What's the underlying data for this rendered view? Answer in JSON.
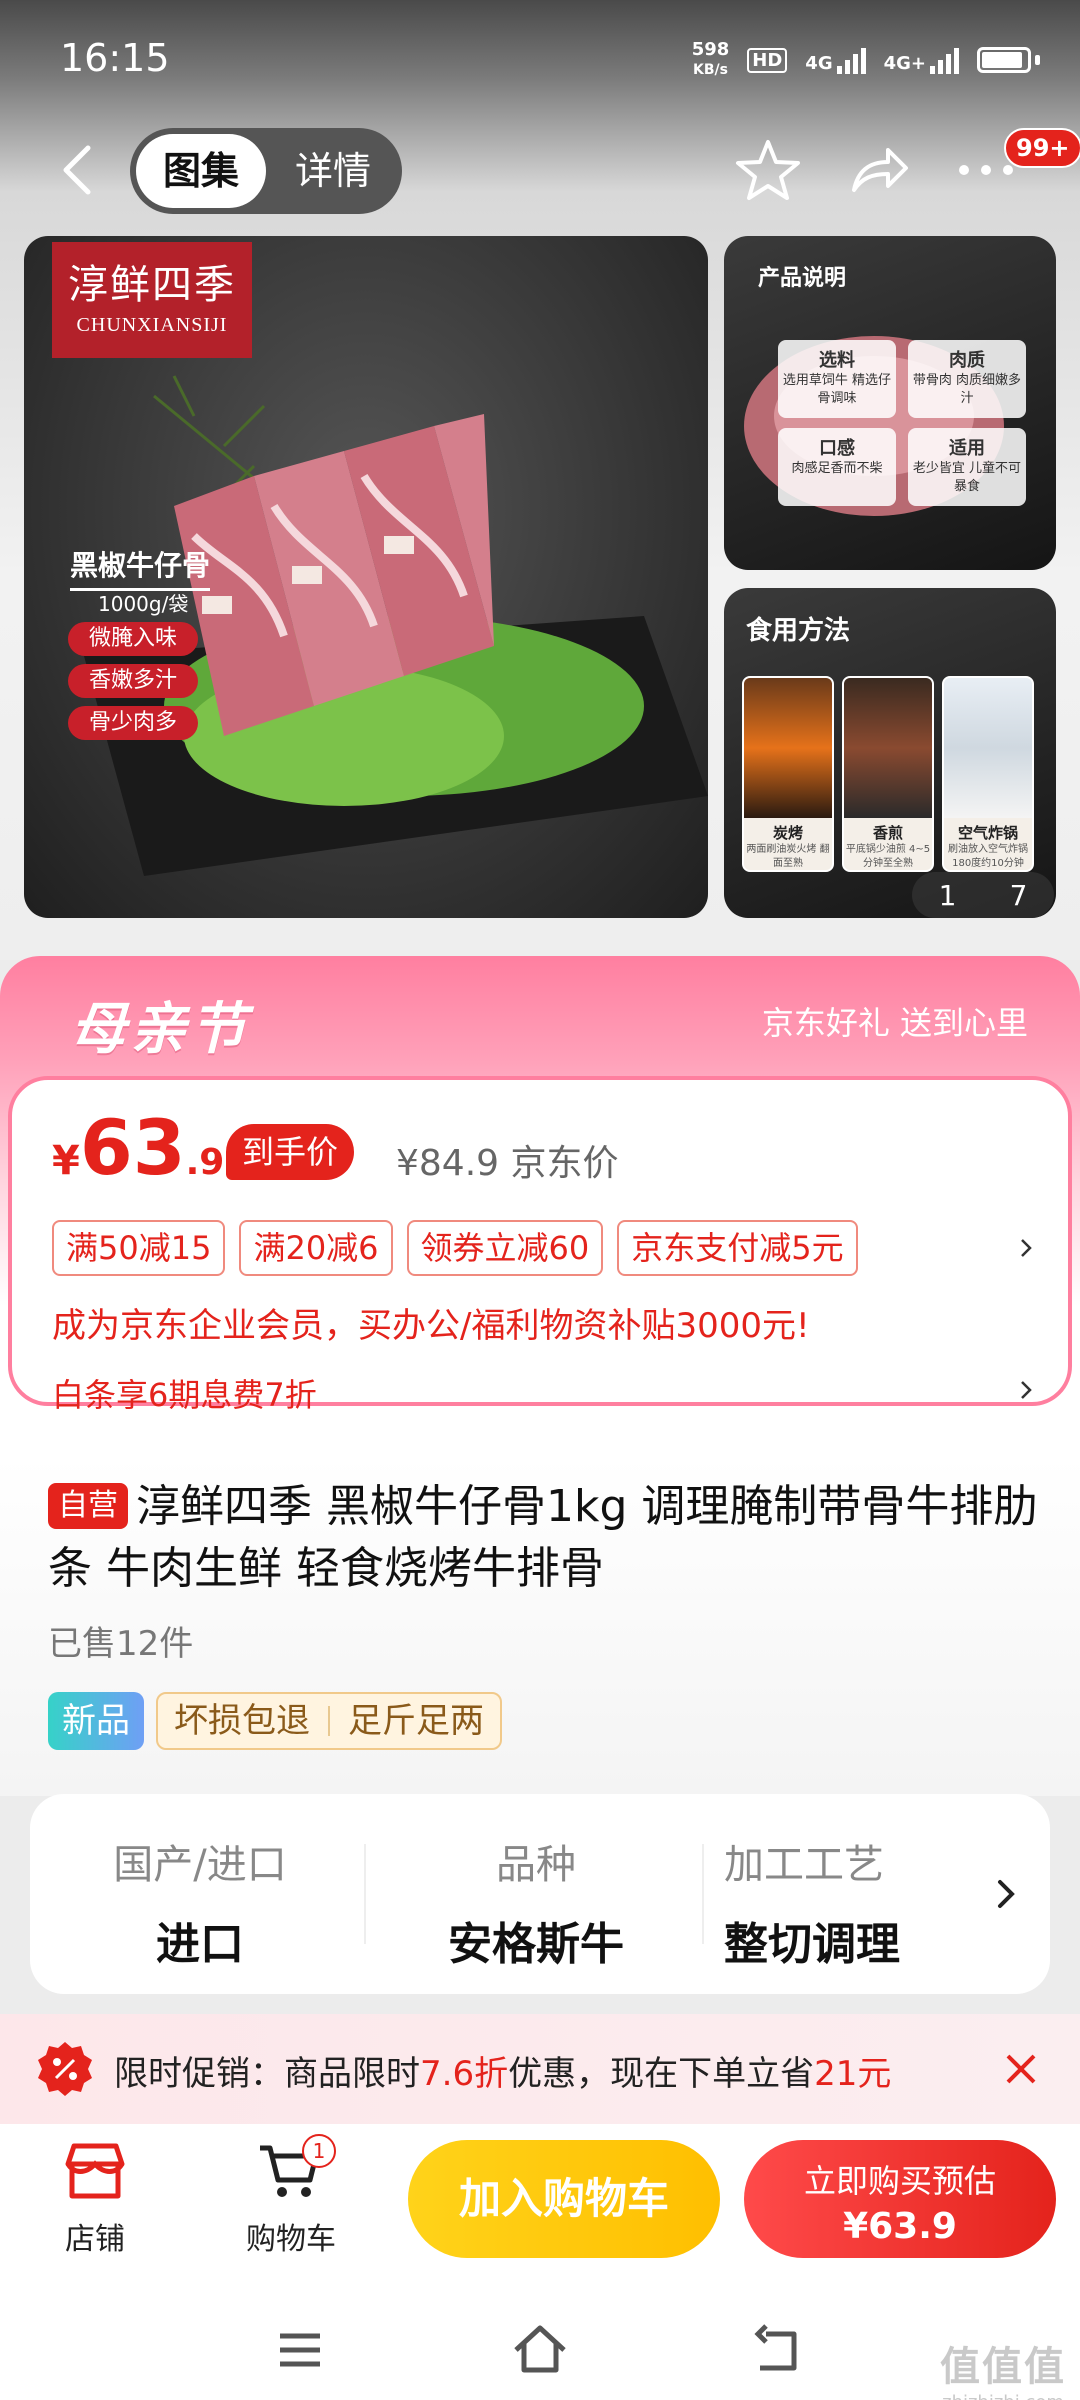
{
  "status_bar": {
    "time": "16:15",
    "net_speed_value": "598",
    "net_speed_unit": "KB/s",
    "hd": "HD",
    "sim1": "4G",
    "sim2": "4G+"
  },
  "nav": {
    "tabs": [
      {
        "label": "图集",
        "active": true
      },
      {
        "label": "详情",
        "active": false
      }
    ],
    "more_badge": "99+",
    "icons": [
      "back-icon",
      "star-icon",
      "share-icon",
      "more-icon"
    ]
  },
  "gallery": {
    "brand_cn": "淳鲜四季",
    "brand_en": "CHUNXIANSIJI",
    "product_name": "黑椒牛仔骨",
    "product_weight": "1000g/袋",
    "feature_tags": [
      "微腌入味",
      "香嫩多汁",
      "骨少肉多"
    ],
    "thumb1": {
      "title": "产品说明",
      "cells": [
        {
          "title": "选料",
          "desc": "选用草饲牛 精选仔骨调味"
        },
        {
          "title": "肉质",
          "desc": "带骨肉 肉质细嫩多汁"
        },
        {
          "title": "口感",
          "desc": "肉感足香而不柴"
        },
        {
          "title": "适用",
          "desc": "老少皆宜 儿童不可暴食"
        }
      ]
    },
    "thumb2": {
      "title": "食用方法",
      "methods": [
        {
          "title": "炭烤",
          "desc": "两面刷油炭火烤 翻面至熟"
        },
        {
          "title": "香煎",
          "desc": "平底锅少油煎 4~5分钟至全熟"
        },
        {
          "title": "空气炸锅",
          "desc": "刷油放入空气炸锅 180度约10分钟"
        }
      ]
    },
    "pager": {
      "current": "1",
      "total": "7"
    }
  },
  "promo": {
    "festival": "母亲节",
    "slogan": "京东好礼 送到心里",
    "price": {
      "currency": "¥",
      "integer": "63",
      "decimal": ".9"
    },
    "final_price_label": "到手价",
    "original_price": "¥84.9 京东价",
    "coupons": [
      "满50减15",
      "满20减6",
      "领券立减60",
      "京东支付减5元"
    ],
    "vip_line": "成为京东企业会员，买办公/福利物资补贴3000元!",
    "baitiao": "白条享6期息费7折"
  },
  "product": {
    "self_tag": "自营",
    "title": "淳鲜四季 黑椒牛仔骨1kg 调理腌制带骨牛排肋条 牛肉生鲜 轻食烧烤牛排骨",
    "sold": "已售12件",
    "tag_new": "新品",
    "service_tags": [
      "坏损包退",
      "足斤足两"
    ]
  },
  "attributes": [
    {
      "key": "国产/进口",
      "value": "进口"
    },
    {
      "key": "品种",
      "value": "安格斯牛"
    },
    {
      "key": "加工工艺",
      "value": "整切调理"
    }
  ],
  "limit_promo": {
    "prefix": "限时促销：商品限时",
    "discount": "7.6折",
    "middle": "优惠，现在下单立省",
    "saving": "21元"
  },
  "actions": {
    "shop": "店铺",
    "cart": "购物车",
    "cart_count": "1",
    "add_to_cart": "加入购物车",
    "buy_line1": "立即购买预估",
    "buy_line2": "¥63.9"
  },
  "watermark": {
    "line1": "值值值",
    "line2": "zhizhizhi.com"
  },
  "colors": {
    "accent_red": "#e4231c",
    "accent_yellow": "#ffc800",
    "promo_pink": "#ff7fa0"
  }
}
